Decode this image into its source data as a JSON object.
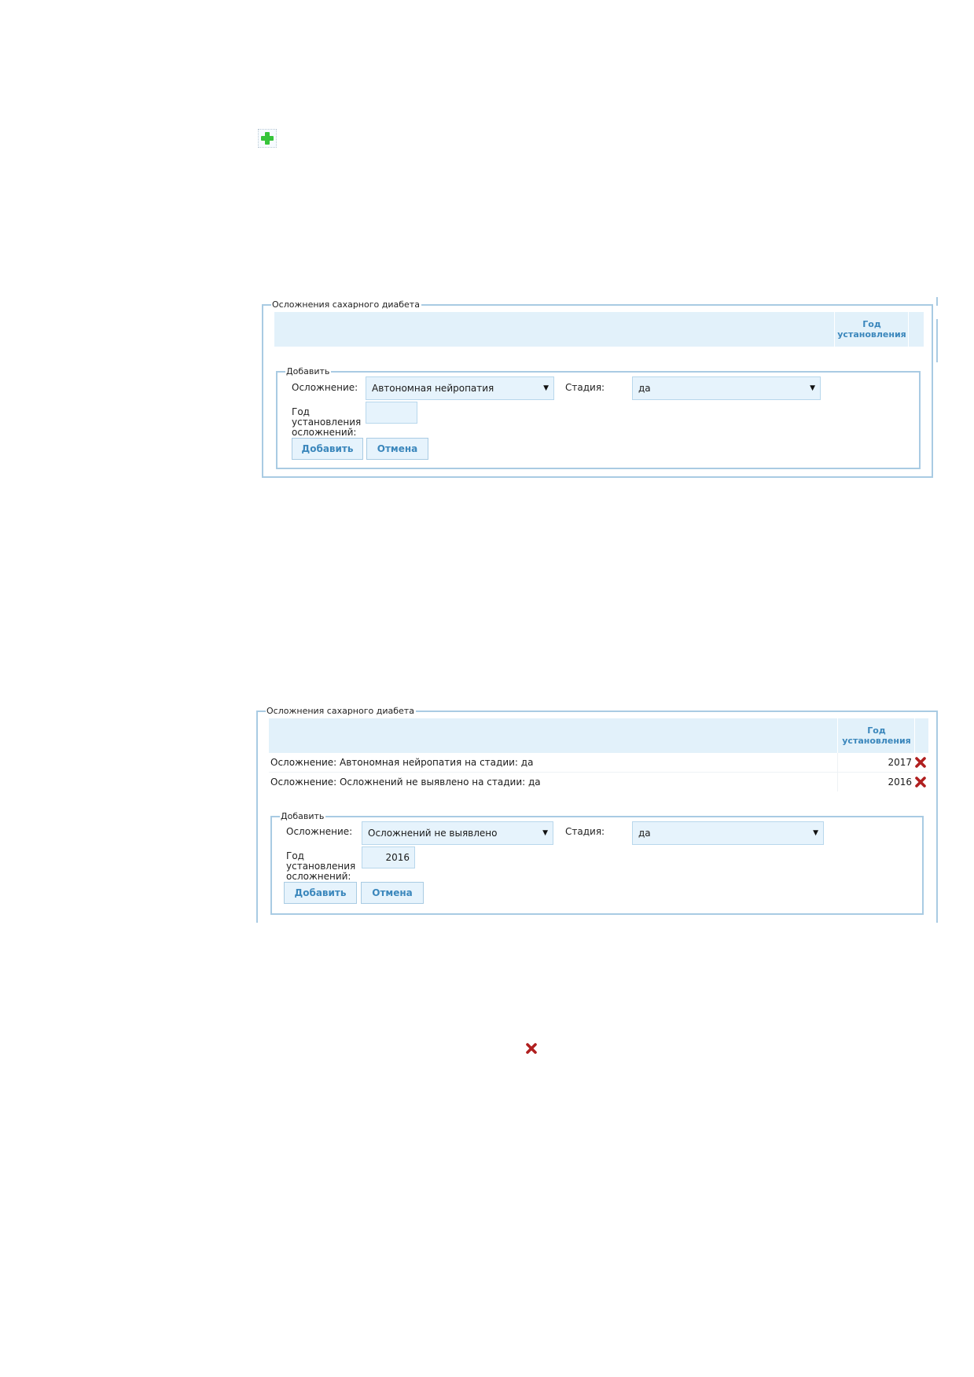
{
  "icons": {
    "add": "plus-icon",
    "delete": "close-icon",
    "add_color": "#33cc33",
    "delete_color": "#b01f1f"
  },
  "panel1": {
    "legend": "Осложнения сахарного диабета",
    "year_header": "Год установления",
    "add": {
      "legend": "Добавить",
      "complication_label": "Осложнение:",
      "complication_value": "Автономная нейропатия",
      "stage_label": "Стадия:",
      "stage_value": "да",
      "year_label": "Год установления осложнений:",
      "year_value": "",
      "add_button": "Добавить",
      "cancel_button": "Отмена"
    }
  },
  "panel2": {
    "legend": "Осложнения сахарного диабета",
    "year_header": "Год установления",
    "rows": [
      {
        "text": "Осложнение: Автономная нейропатия на стадии: да",
        "year": "2017"
      },
      {
        "text": "Осложнение: Осложнений не выявлено на стадии: да",
        "year": "2016"
      }
    ],
    "add": {
      "legend": "Добавить",
      "complication_label": "Осложнение:",
      "complication_value": "Осложнений не выявлено",
      "stage_label": "Стадия:",
      "stage_value": "да",
      "year_label": "Год установления осложнений:",
      "year_value": "2016",
      "add_button": "Добавить",
      "cancel_button": "Отмена"
    }
  },
  "colors": {
    "accent": "#3b87bc",
    "border": "#a9cbe3",
    "field_bg": "#e6f3fc",
    "header_bg": "#e2f1fa"
  }
}
